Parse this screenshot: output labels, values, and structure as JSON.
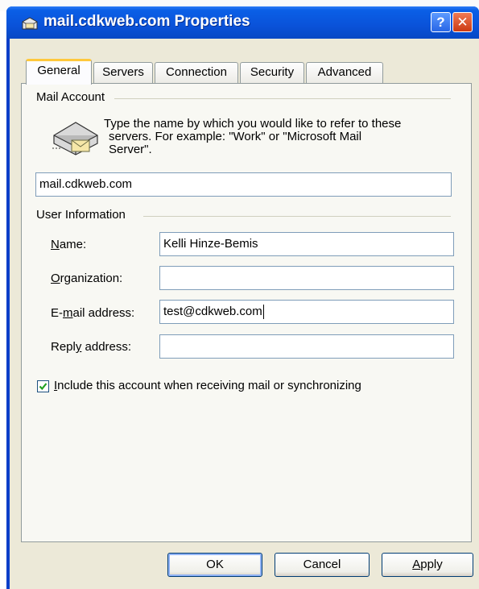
{
  "window": {
    "title": "mail.cdkweb.com Properties",
    "help_label": "?",
    "close_label": "✕"
  },
  "tabs": [
    {
      "label": "General",
      "active": true
    },
    {
      "label": "Servers",
      "active": false
    },
    {
      "label": "Connection",
      "active": false
    },
    {
      "label": "Security",
      "active": false
    },
    {
      "label": "Advanced",
      "active": false
    }
  ],
  "mail_account": {
    "group_label": "Mail Account",
    "description_lines": [
      "Type the name by which you would like to refer to these",
      "servers.  For example: \"Work\" or \"Microsoft Mail",
      "Server\"."
    ],
    "account_name": "mail.cdkweb.com"
  },
  "user_info": {
    "group_label": "User Information",
    "name_label_hot": "N",
    "name_label_rest": "ame:",
    "name_value": "Kelli Hinze-Bemis",
    "org_label_hot": "O",
    "org_label_rest": "rganization:",
    "org_value": "",
    "email_label_pre": "E-",
    "email_label_hot": "m",
    "email_label_rest": "ail address:",
    "email_value": "test@cdkweb.com",
    "reply_label_pre": "Repl",
    "reply_label_hot": "y",
    "reply_label_rest": " address:",
    "reply_value": ""
  },
  "include_checkbox": {
    "checked": true,
    "label_hot": "I",
    "label_rest": "nclude this account when receiving mail or synchronizing"
  },
  "buttons": {
    "ok": "OK",
    "cancel": "Cancel",
    "apply_hot": "A",
    "apply_rest": "pply"
  },
  "icons": {
    "title": "mail-account-icon",
    "account": "mail-server-icon",
    "check": "checkmark-icon"
  },
  "colors": {
    "titlebar": "#0a52d9",
    "dialog_face": "#ece9d8",
    "active_tab_highlight": "#ffc83c",
    "close_button": "#cc3a13"
  }
}
